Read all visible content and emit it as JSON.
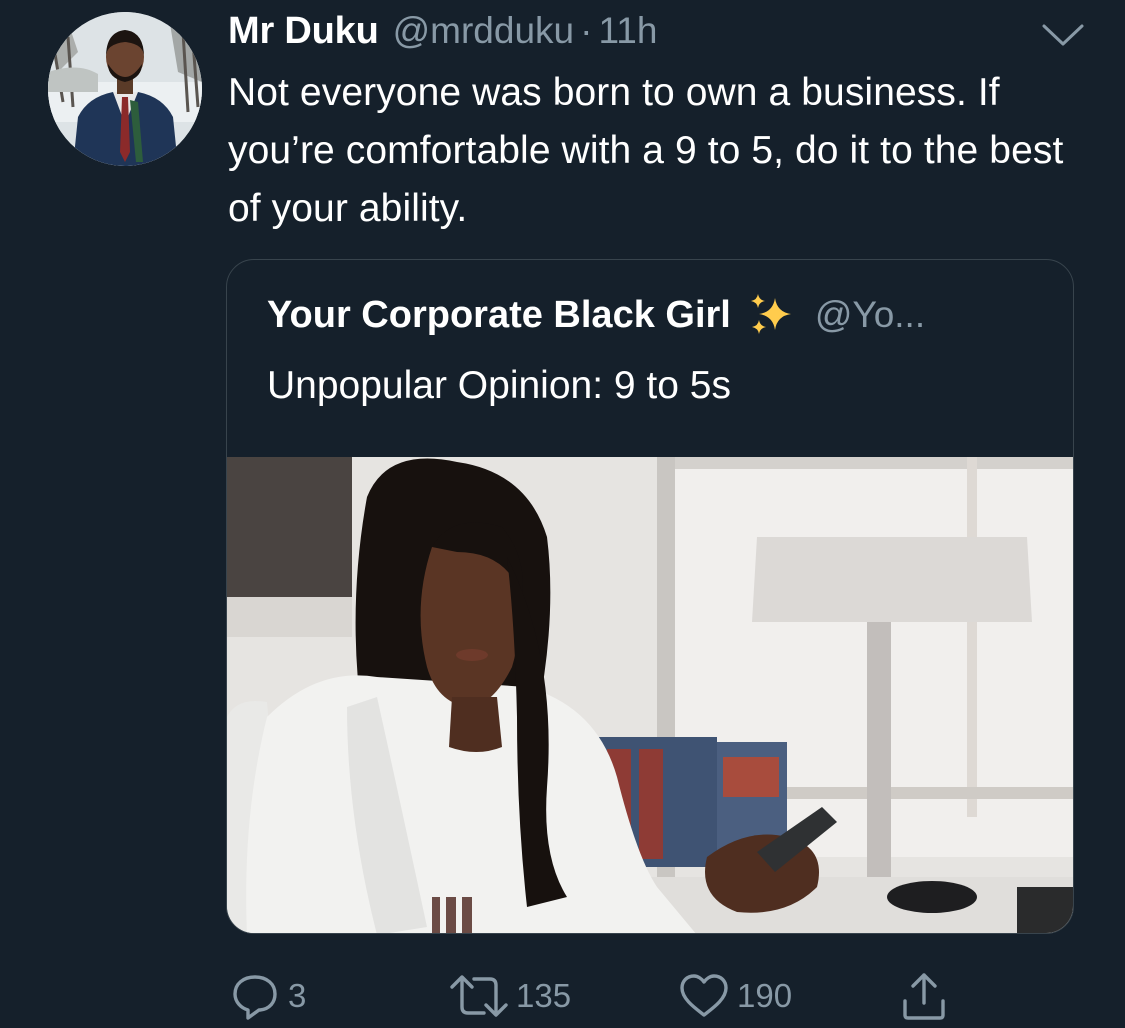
{
  "author": {
    "name": "Mr Duku",
    "handle": "@mrdduku",
    "separator": "·",
    "time": "11h",
    "avatar_icon": "profile-photo"
  },
  "tweet": {
    "text": "Not everyone was born to own a business. If you’re comfortable with a 9 to 5, do it to the best of your ability."
  },
  "quoted": {
    "name": "Your Corporate Black Girl",
    "emoji": "sparkles-emoji",
    "handle": "@Yo...",
    "text": "Unpopular Opinion: 9 to 5s",
    "image_icon": "woman-at-office-desk-photo"
  },
  "actions": {
    "reply": {
      "icon": "reply-icon",
      "count": "3"
    },
    "retweet": {
      "icon": "retweet-icon",
      "count": "135"
    },
    "like": {
      "icon": "heart-icon",
      "count": "190"
    },
    "share": {
      "icon": "share-icon"
    }
  },
  "colors": {
    "background": "#15202b",
    "secondary_text": "#8899a6",
    "border": "#38444d",
    "primary_text": "#ffffff"
  }
}
